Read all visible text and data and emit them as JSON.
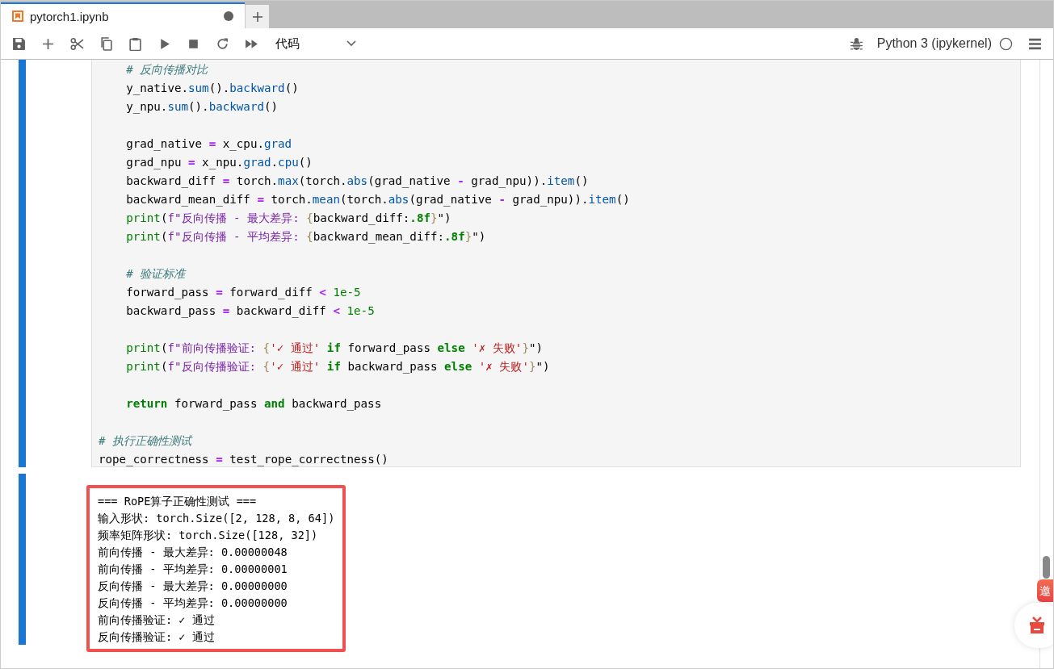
{
  "tab": {
    "title": "pytorch1.ipynb",
    "modified": true
  },
  "toolbar": {
    "cell_type": "代码",
    "kernel": "Python 3 (ipykernel)",
    "kernel_busy": false
  },
  "code_cell": {
    "selected": true,
    "lines": [
      {
        "gap_before": false,
        "indented": true,
        "tokens": [
          {
            "t": "# 反向传播对比",
            "kind": "comment"
          }
        ]
      },
      {
        "gap_before": false,
        "indented": true,
        "tokens": [
          {
            "t": "y_native.",
            "kind": "plain"
          },
          {
            "t": "sum",
            "kind": "attr"
          },
          {
            "t": "().",
            "kind": "plain"
          },
          {
            "t": "backward",
            "kind": "attr"
          },
          {
            "t": "()",
            "kind": "plain"
          }
        ]
      },
      {
        "gap_before": false,
        "indented": true,
        "tokens": [
          {
            "t": "y_npu.",
            "kind": "plain"
          },
          {
            "t": "sum",
            "kind": "attr"
          },
          {
            "t": "().",
            "kind": "plain"
          },
          {
            "t": "backward",
            "kind": "attr"
          },
          {
            "t": "()",
            "kind": "plain"
          }
        ]
      },
      {
        "gap_before": true,
        "indented": true,
        "tokens": [
          {
            "t": "grad_native ",
            "kind": "plain"
          },
          {
            "t": "=",
            "kind": "op"
          },
          {
            "t": " x_cpu.",
            "kind": "plain"
          },
          {
            "t": "grad",
            "kind": "attr"
          }
        ]
      },
      {
        "gap_before": false,
        "indented": true,
        "tokens": [
          {
            "t": "grad_npu ",
            "kind": "plain"
          },
          {
            "t": "=",
            "kind": "op"
          },
          {
            "t": " x_npu.",
            "kind": "plain"
          },
          {
            "t": "grad",
            "kind": "attr"
          },
          {
            "t": ".",
            "kind": "plain"
          },
          {
            "t": "cpu",
            "kind": "attr"
          },
          {
            "t": "()",
            "kind": "plain"
          }
        ]
      },
      {
        "gap_before": false,
        "indented": true,
        "tokens": [
          {
            "t": "backward_diff ",
            "kind": "plain"
          },
          {
            "t": "=",
            "kind": "op"
          },
          {
            "t": " torch.",
            "kind": "plain"
          },
          {
            "t": "max",
            "kind": "attr"
          },
          {
            "t": "(torch.",
            "kind": "plain"
          },
          {
            "t": "abs",
            "kind": "attr"
          },
          {
            "t": "(grad_native ",
            "kind": "plain"
          },
          {
            "t": "-",
            "kind": "op"
          },
          {
            "t": " grad_npu)).",
            "kind": "plain"
          },
          {
            "t": "item",
            "kind": "attr"
          },
          {
            "t": "()",
            "kind": "plain"
          }
        ]
      },
      {
        "gap_before": false,
        "indented": true,
        "tokens": [
          {
            "t": "backward_mean_diff ",
            "kind": "plain"
          },
          {
            "t": "=",
            "kind": "op"
          },
          {
            "t": " torch.",
            "kind": "plain"
          },
          {
            "t": "mean",
            "kind": "attr"
          },
          {
            "t": "(torch.",
            "kind": "plain"
          },
          {
            "t": "abs",
            "kind": "attr"
          },
          {
            "t": "(grad_native ",
            "kind": "plain"
          },
          {
            "t": "-",
            "kind": "op"
          },
          {
            "t": " grad_npu)).",
            "kind": "plain"
          },
          {
            "t": "item",
            "kind": "attr"
          },
          {
            "t": "()",
            "kind": "plain"
          }
        ]
      },
      {
        "gap_before": false,
        "indented": true,
        "tokens": [
          {
            "t": "print",
            "kind": "builtin"
          },
          {
            "t": "(",
            "kind": "plain"
          },
          {
            "t": "f\"反向传播 - 最大差异: ",
            "kind": "fstr"
          },
          {
            "t": "{",
            "kind": "brace"
          },
          {
            "t": "backward_diff:",
            "kind": "plain"
          },
          {
            "t": ".8f",
            "kind": "fmt"
          },
          {
            "t": "}",
            "kind": "brace"
          },
          {
            "t": "\")",
            "kind": "plain"
          }
        ]
      },
      {
        "gap_before": false,
        "indented": true,
        "tokens": [
          {
            "t": "print",
            "kind": "builtin"
          },
          {
            "t": "(",
            "kind": "plain"
          },
          {
            "t": "f\"反向传播 - 平均差异: ",
            "kind": "fstr"
          },
          {
            "t": "{",
            "kind": "brace"
          },
          {
            "t": "backward_mean_diff:",
            "kind": "plain"
          },
          {
            "t": ".8f",
            "kind": "fmt"
          },
          {
            "t": "}",
            "kind": "brace"
          },
          {
            "t": "\")",
            "kind": "plain"
          }
        ]
      },
      {
        "gap_before": true,
        "indented": true,
        "tokens": [
          {
            "t": "# 验证标准",
            "kind": "comment"
          }
        ]
      },
      {
        "gap_before": false,
        "indented": true,
        "tokens": [
          {
            "t": "forward_pass ",
            "kind": "plain"
          },
          {
            "t": "=",
            "kind": "op"
          },
          {
            "t": " forward_diff ",
            "kind": "plain"
          },
          {
            "t": "<",
            "kind": "op"
          },
          {
            "t": " 1e-5",
            "kind": "num"
          }
        ]
      },
      {
        "gap_before": false,
        "indented": true,
        "tokens": [
          {
            "t": "backward_pass ",
            "kind": "plain"
          },
          {
            "t": "=",
            "kind": "op"
          },
          {
            "t": " backward_diff ",
            "kind": "plain"
          },
          {
            "t": "<",
            "kind": "op"
          },
          {
            "t": " 1e-5",
            "kind": "num"
          }
        ]
      },
      {
        "gap_before": true,
        "indented": true,
        "tokens": [
          {
            "t": "print",
            "kind": "builtin"
          },
          {
            "t": "(",
            "kind": "plain"
          },
          {
            "t": "f\"前向传播验证: ",
            "kind": "fstr"
          },
          {
            "t": "{",
            "kind": "brace"
          },
          {
            "t": "'✓ 通过'",
            "kind": "str"
          },
          {
            "t": " if",
            "kind": "kw"
          },
          {
            "t": " forward_pass ",
            "kind": "plain"
          },
          {
            "t": "else ",
            "kind": "kw"
          },
          {
            "t": "'✗ 失败'",
            "kind": "str"
          },
          {
            "t": "}",
            "kind": "brace"
          },
          {
            "t": "\")",
            "kind": "plain"
          }
        ]
      },
      {
        "gap_before": false,
        "indented": true,
        "tokens": [
          {
            "t": "print",
            "kind": "builtin"
          },
          {
            "t": "(",
            "kind": "plain"
          },
          {
            "t": "f\"反向传播验证: ",
            "kind": "fstr"
          },
          {
            "t": "{",
            "kind": "brace"
          },
          {
            "t": "'✓ 通过'",
            "kind": "str"
          },
          {
            "t": " if",
            "kind": "kw"
          },
          {
            "t": " backward_pass ",
            "kind": "plain"
          },
          {
            "t": "else ",
            "kind": "kw"
          },
          {
            "t": "'✗ 失败'",
            "kind": "str"
          },
          {
            "t": "}",
            "kind": "brace"
          },
          {
            "t": "\")",
            "kind": "plain"
          }
        ]
      },
      {
        "gap_before": true,
        "indented": true,
        "tokens": [
          {
            "t": "return",
            "kind": "kw"
          },
          {
            "t": " forward_pass ",
            "kind": "plain"
          },
          {
            "t": "and",
            "kind": "kw"
          },
          {
            "t": " backward_pass",
            "kind": "plain"
          }
        ]
      },
      {
        "gap_before": true,
        "indented": false,
        "tokens": [
          {
            "t": "# 执行正确性测试",
            "kind": "comment"
          }
        ]
      },
      {
        "gap_before": false,
        "indented": false,
        "tokens": [
          {
            "t": "rope_correctness ",
            "kind": "plain"
          },
          {
            "t": "=",
            "kind": "op"
          },
          {
            "t": " test_rope_correctness()",
            "kind": "plain"
          }
        ]
      }
    ]
  },
  "output_cell": {
    "highlighted": true,
    "lines": [
      "=== RoPE算子正确性测试 ===",
      "输入形状: torch.Size([2, 128, 8, 64])",
      "频率矩阵形状: torch.Size([128, 32])",
      "前向传播 - 最大差异: 0.00000048",
      "前向传播 - 平均差异: 0.00000001",
      "反向传播 - 最大差异: 0.00000000",
      "反向传播 - 平均差异: 0.00000000",
      "前向传播验证: ✓ 通过",
      "反向传播验证: ✓ 通过"
    ]
  },
  "invite_badge": {
    "label": "邀"
  }
}
